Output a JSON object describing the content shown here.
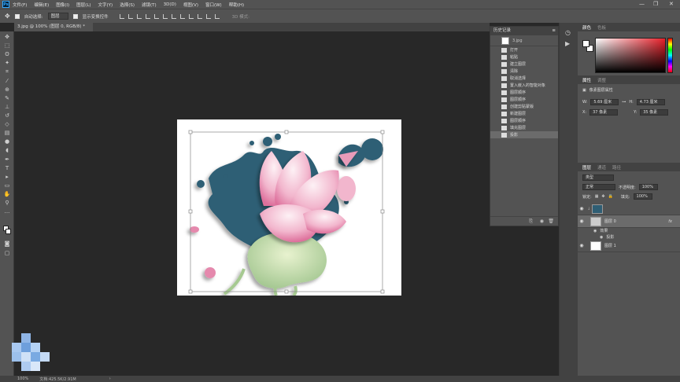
{
  "menubar": {
    "logo": "Ps",
    "items": [
      "文件(F)",
      "编辑(E)",
      "图像(I)",
      "图层(L)",
      "文字(Y)",
      "选择(S)",
      "滤镜(T)",
      "3D(D)",
      "视图(V)",
      "窗口(W)",
      "帮助(H)"
    ],
    "minimize": "—",
    "restore": "❐",
    "close": "✕"
  },
  "options": {
    "auto_select_label": "自动选择:",
    "auto_select_value": "图层",
    "transform_label": "显示变换控件",
    "three_d_label": "3D 模式:"
  },
  "tab": {
    "title": "3.jpg @ 100% (图层 0, RGB/8) *",
    "close": "×"
  },
  "status": {
    "zoom": "100%",
    "doc": "文档:425.5K/2.91M",
    "arrow": "›"
  },
  "history": {
    "title": "历史记录",
    "snapshot": "3.jpg",
    "items": [
      "打开",
      "粘贴",
      "建立图层",
      "清除",
      "取消选择",
      "置入嵌入的智能对象",
      "图层顺序",
      "图层顺序",
      "创建剪贴蒙版",
      "新建图层",
      "图层顺序",
      "填充图层",
      "投影"
    ],
    "selected_index": 12
  },
  "color_panel": {
    "tab_active": "颜色",
    "tab_inactive": "色板"
  },
  "properties": {
    "tab_active": "属性",
    "tab_inactive": "调整",
    "subtitle": "像素图层属性",
    "w_label": "W:",
    "w_value": "5.69 厘米",
    "h_label": "H:",
    "h_value": "4.73 厘米",
    "x_label": "X:",
    "x_value": "37 像素",
    "y_label": "Y:",
    "y_value": "35 像素"
  },
  "layers": {
    "tab_active": "图层",
    "tab_channels": "通道",
    "tab_paths": "路径",
    "kind": "类型",
    "blend": "正常",
    "opacity_label": "不透明度:",
    "opacity_value": "100%",
    "lock_label": "锁定:",
    "fill_label": "填充:",
    "fill_value": "100%",
    "layer0": "图层 0",
    "fx": "fx",
    "effects": "效果",
    "shadow": "投影",
    "layer1": "图层 1"
  }
}
